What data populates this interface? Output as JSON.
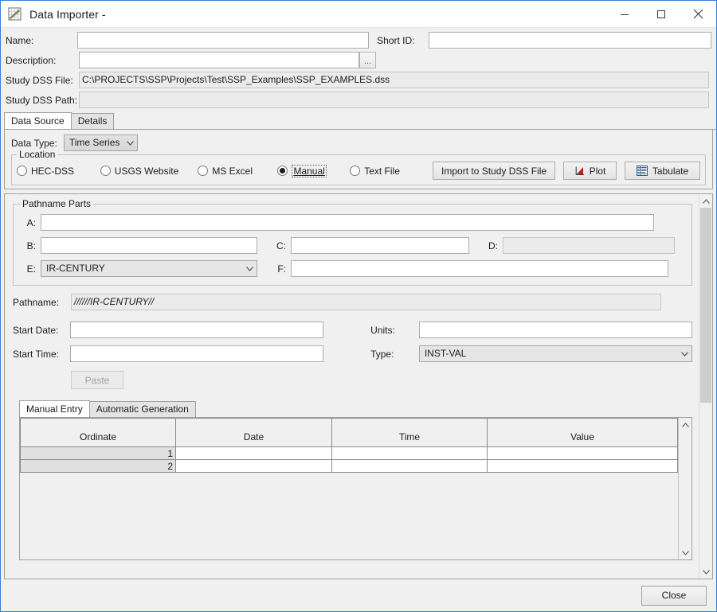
{
  "window": {
    "title": "Data Importer -",
    "icon": "chart-document-icon",
    "controls": {
      "minimize": "minimize-icon",
      "maximize": "maximize-icon",
      "close": "close-icon"
    }
  },
  "form": {
    "name_label": "Name:",
    "name_value": "",
    "short_id_label": "Short ID:",
    "short_id_value": "",
    "description_label": "Description:",
    "description_value": "",
    "browse_button": "...",
    "study_dss_file_label": "Study DSS File:",
    "study_dss_file_value": "C:\\PROJECTS\\SSP\\Projects\\Test\\SSP_Examples\\SSP_EXAMPLES.dss",
    "study_dss_path_label": "Study DSS Path:",
    "study_dss_path_value": ""
  },
  "tabs": [
    {
      "label": "Data Source",
      "active": true
    },
    {
      "label": "Details",
      "active": false
    }
  ],
  "data_source": {
    "data_type_label": "Data Type:",
    "data_type_value": "Time Series",
    "location_group_title": "Location",
    "location_options": [
      {
        "label": "HEC-DSS",
        "selected": false
      },
      {
        "label": "USGS Website",
        "selected": false
      },
      {
        "label": "MS Excel",
        "selected": false
      },
      {
        "label": "Manual",
        "selected": true
      },
      {
        "label": "Text File",
        "selected": false
      }
    ],
    "buttons": [
      {
        "label": "Import to Study DSS File",
        "icon": ""
      },
      {
        "label": "Plot",
        "icon": "plot-icon"
      },
      {
        "label": "Tabulate",
        "icon": "table-icon"
      }
    ]
  },
  "pathname_parts": {
    "title": "Pathname Parts",
    "a_label": "A:",
    "a_value": "",
    "b_label": "B:",
    "b_value": "",
    "c_label": "C:",
    "c_value": "",
    "d_label": "D:",
    "d_value": "",
    "e_label": "E:",
    "e_value": "IR-CENTURY",
    "f_label": "F:",
    "f_value": ""
  },
  "pathname": {
    "label": "Pathname:",
    "value": "//////IR-CENTURY//"
  },
  "timeseries": {
    "start_date_label": "Start Date:",
    "start_date_value": "",
    "start_time_label": "Start Time:",
    "start_time_value": "",
    "units_label": "Units:",
    "units_value": "",
    "type_label": "Type:",
    "type_value": "INST-VAL",
    "paste_button": "Paste"
  },
  "entry_tabs": [
    {
      "label": "Manual Entry",
      "active": true
    },
    {
      "label": "Automatic Generation",
      "active": false
    }
  ],
  "table": {
    "columns": [
      "Ordinate",
      "Date",
      "Time",
      "Value"
    ],
    "rows": [
      {
        "ordinate": "1",
        "date": "",
        "time": "",
        "value": ""
      },
      {
        "ordinate": "2",
        "date": "",
        "time": "",
        "value": ""
      }
    ]
  },
  "scrollbar": {
    "up_arrow": "chevron-up-icon",
    "down_arrow": "chevron-down-icon"
  },
  "footer": {
    "close_label": "Close"
  },
  "colors": {
    "window_border": "#3a7fd5",
    "panel_bg": "#f0f0f0",
    "field_border": "#abadb3",
    "accent_red": "#c41a1a",
    "scroll_thumb": "#cdcdcd"
  }
}
